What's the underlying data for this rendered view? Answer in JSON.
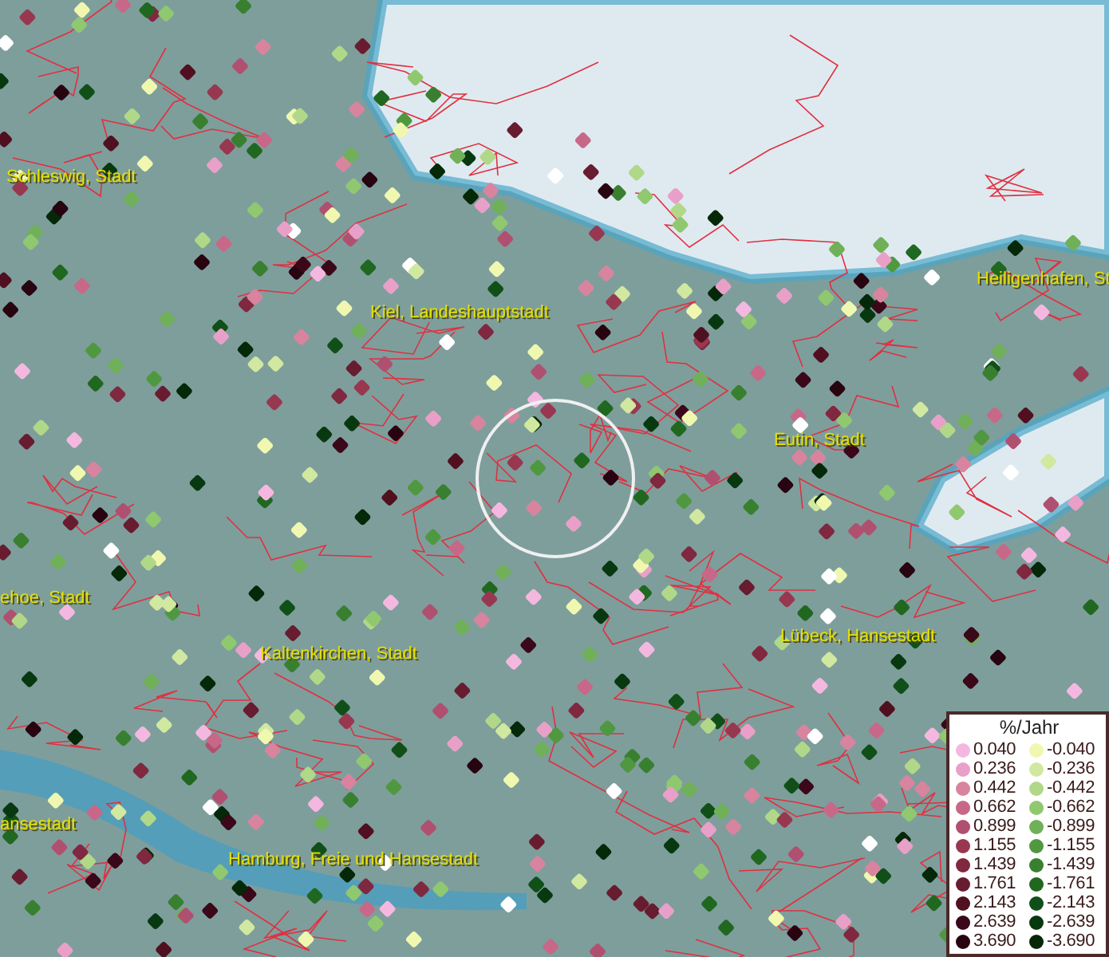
{
  "map": {
    "places": [
      {
        "name": "Schleswig, Stadt"
      },
      {
        "name": "Kiel, Landeshauptstadt"
      },
      {
        "name": "Heiligenhafen, St"
      },
      {
        "name": "Eutin, Stadt"
      },
      {
        "name": "ehoe, Stadt"
      },
      {
        "name": "Kaltenkirchen, Stadt"
      },
      {
        "name": "Lübeck, Hansestadt"
      },
      {
        "name": "ansestadt"
      },
      {
        "name": "Hamburg, Freie und Hansestadt"
      }
    ]
  },
  "legend": {
    "title": "%/Jahr",
    "rows": [
      {
        "positive": {
          "value": "0.040",
          "color": "#f4b8e0"
        },
        "negative": {
          "value": "-0.040",
          "color": "#f0f8b0"
        }
      },
      {
        "positive": {
          "value": "0.236",
          "color": "#e8a0c8"
        },
        "negative": {
          "value": "-0.236",
          "color": "#d0e8a0"
        }
      },
      {
        "positive": {
          "value": "0.442",
          "color": "#d8849f"
        },
        "negative": {
          "value": "-0.442",
          "color": "#b0d888"
        }
      },
      {
        "positive": {
          "value": "0.662",
          "color": "#c86888"
        },
        "negative": {
          "value": "-0.662",
          "color": "#90c870"
        }
      },
      {
        "positive": {
          "value": "0.899",
          "color": "#b05070"
        },
        "negative": {
          "value": "-0.899",
          "color": "#70b058"
        }
      },
      {
        "positive": {
          "value": "1.155",
          "color": "#983850"
        },
        "negative": {
          "value": "-1.155",
          "color": "#509840"
        }
      },
      {
        "positive": {
          "value": "1.439",
          "color": "#802840"
        },
        "negative": {
          "value": "-1.439",
          "color": "#388030"
        }
      },
      {
        "positive": {
          "value": "1.761",
          "color": "#681c30"
        },
        "negative": {
          "value": "-1.761",
          "color": "#206820"
        }
      },
      {
        "positive": {
          "value": "2.143",
          "color": "#501020"
        },
        "negative": {
          "value": "-2.143",
          "color": "#105018"
        }
      },
      {
        "positive": {
          "value": "2.639",
          "color": "#3a0818"
        },
        "negative": {
          "value": "-2.639",
          "color": "#083810"
        }
      },
      {
        "positive": {
          "value": "3.690",
          "color": "#280410"
        },
        "negative": {
          "value": "-3.690",
          "color": "#042808"
        }
      }
    ]
  }
}
